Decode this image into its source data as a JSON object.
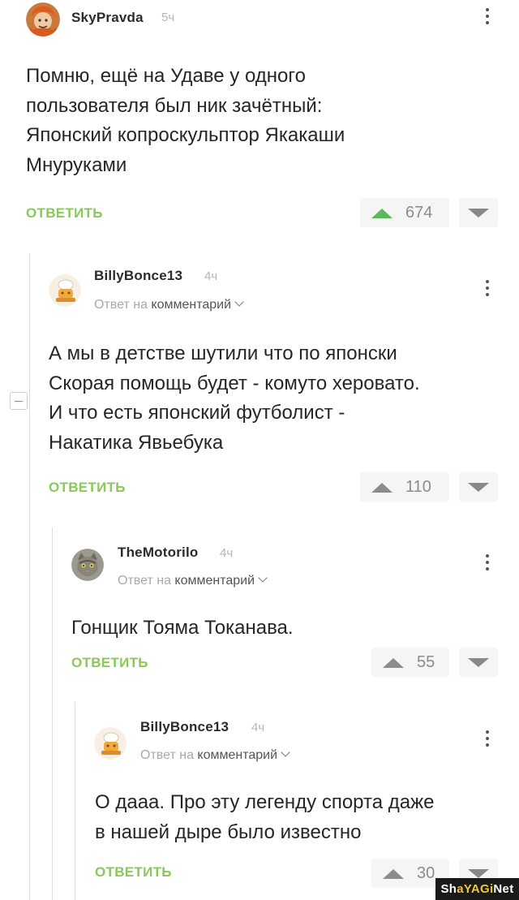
{
  "comments": [
    {
      "username": "SkyPravda",
      "time": "5ч",
      "text_lines": [
        "Помню, ещё на Удаве у одного",
        "пользователя был ник зачётный:",
        "Японский копроскульптор Якакаши",
        "Мнуруками"
      ],
      "reply_label": "ОТВЕТИТЬ",
      "votes": "674",
      "avatar_icon": "avatar-redhead-icon"
    },
    {
      "username": "BillyBonce13",
      "time": "4ч",
      "reply_prefix": "Ответ на",
      "reply_target": "комментарий",
      "text_lines": [
        "А мы в детстве шутили что по японски",
        "Скорая помощь будет - комуто херовато.",
        "И что есть японский футболист -",
        "Накатика Явьебука"
      ],
      "reply_label": "ОТВЕТИТЬ",
      "votes": "110",
      "avatar_icon": "avatar-chef-icon"
    },
    {
      "username": "TheMotorilo",
      "time": "4ч",
      "reply_prefix": "Ответ на",
      "reply_target": "комментарий",
      "text_lines": [
        "Гонщик Тояма Токанава."
      ],
      "reply_label": "ОТВЕТИТЬ",
      "votes": "55",
      "avatar_icon": "avatar-cat-icon"
    },
    {
      "username": "BillyBonce13",
      "time": "4ч",
      "reply_prefix": "Ответ на",
      "reply_target": "комментарий",
      "text_lines": [
        "О дааа. Про эту легенду спорта даже",
        "в нашей дыре было известно"
      ],
      "reply_label": "ОТВЕТИТЬ",
      "votes": "30",
      "avatar_icon": "avatar-chef-icon"
    }
  ],
  "watermark": {
    "part1": "Sh",
    "part2": "aYAGi",
    "part3": "Net"
  },
  "colors": {
    "accent_green": "#8ac858",
    "upvote_green": "#5cb85c",
    "upvote_gray": "#8c8c8c"
  }
}
